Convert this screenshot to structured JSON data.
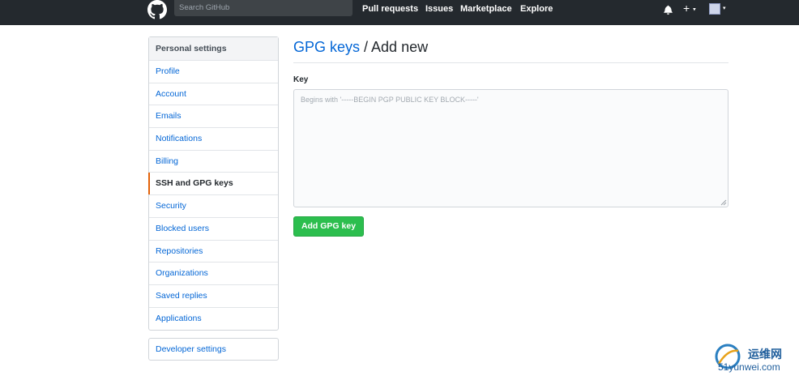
{
  "header": {
    "logo_icon": "github-octocat-icon",
    "search_placeholder": "Search GitHub",
    "nav": [
      "Pull requests",
      "Issues",
      "Marketplace",
      "Explore"
    ],
    "bell_icon": "bell-icon",
    "plus_label": "+",
    "caret": "▾"
  },
  "sidebar": {
    "heading": "Personal settings",
    "items": [
      {
        "label": "Profile"
      },
      {
        "label": "Account"
      },
      {
        "label": "Emails"
      },
      {
        "label": "Notifications"
      },
      {
        "label": "Billing"
      },
      {
        "label": "SSH and GPG keys",
        "selected": true
      },
      {
        "label": "Security"
      },
      {
        "label": "Blocked users"
      },
      {
        "label": "Repositories"
      },
      {
        "label": "Organizations"
      },
      {
        "label": "Saved replies"
      },
      {
        "label": "Applications"
      }
    ],
    "developer": "Developer settings"
  },
  "main": {
    "title_link": "GPG keys",
    "title_rest": " / Add new",
    "key_label": "Key",
    "key_placeholder": "Begins with '-----BEGIN PGP PUBLIC KEY BLOCK-----'",
    "key_value": "",
    "submit_label": "Add GPG key"
  },
  "watermark": {
    "cn": "运维网",
    "url": "51yunwei.com"
  },
  "colors": {
    "header_bg": "#24292e",
    "link": "#0366d6",
    "selected_accent": "#e36209",
    "button_green": "#2cbe4e"
  }
}
